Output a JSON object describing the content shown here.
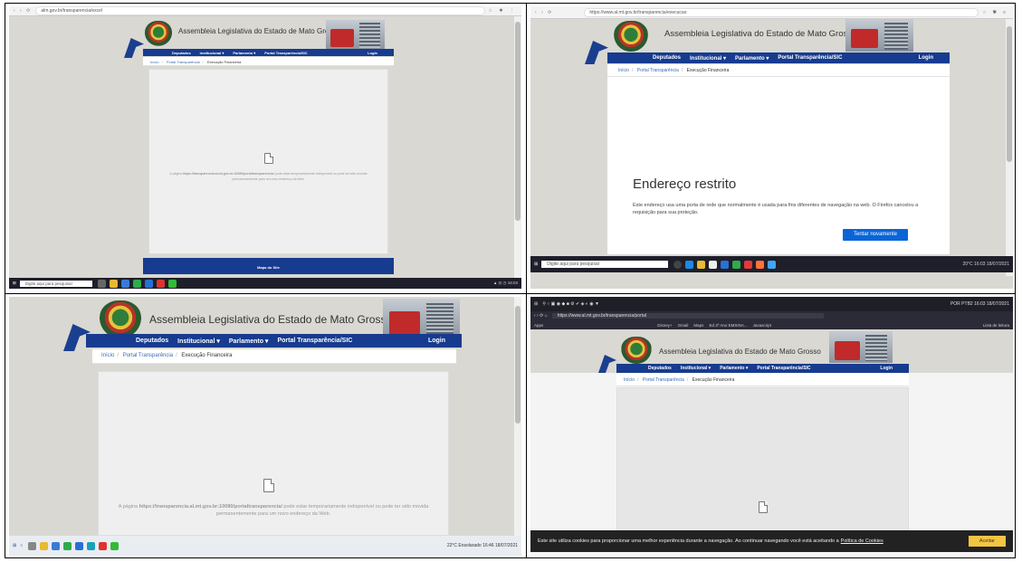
{
  "site": {
    "title": "Assembleia Legislativa do Estado de Mato Grosso",
    "nav": [
      "Deputados",
      "Institucional ▾",
      "Parlamento ▾",
      "Portal Transparência/SIC"
    ],
    "login": "Login",
    "breadcrumb": [
      "Início",
      "Portal Transparência",
      "Execução Financeira"
    ],
    "unavailable_msg_prefix": "A página ",
    "unavailable_url": "https://transparencia.al.mt.gov.br:10080/portaltransparencia/",
    "unavailable_msg_suffix": " pode estar temporariamente indisponível ou pode ter sido movida permanentemente para um novo endereço da Web.",
    "footer_link": "Mapa do Site"
  },
  "q1": {
    "url": "alm.gov.br/transparencia/excel",
    "taskbar_search": "Digite aqui para pesquisar"
  },
  "q2": {
    "url": "https://www.al.mt.gov.br/transparencia/execucao",
    "error_title": "Endereço restrito",
    "error_text": "Este endereço usa uma porta de rede que normalmente é usada para fins diferentes de navegação na web. O Firefox cancelou a requisição para sua proteção.",
    "retry": "Tentar novamente",
    "taskbar_search": "Digite aqui para pesquisar",
    "tray": "20°C   16:03  18/07/2021"
  },
  "q3": {
    "tray": "22°C  Ensolarado   16:46  18/07/2021"
  },
  "q4": {
    "url": "https://www.al.mt.gov.br/transparencia/portal",
    "bookmarks": [
      "Apps",
      "Disney+",
      "Gmail",
      "Maps",
      "Ed 3º Ano EMSINA...",
      "Javascript",
      "Lista de leitura"
    ],
    "tray": "POR PTB2  16:03  18/07/2021",
    "cookie_text": "Este site utiliza cookies para proporcionar uma melhor experiência durante a navegação. Ao continuar navegando você está aceitando a",
    "cookie_policy": "Política de Cookies",
    "accept": "Aceitar"
  },
  "colors": {
    "navbar": "#173b8e",
    "page_bg": "#d9d8d2",
    "retry": "#0a64d8",
    "accept": "#f5c542"
  }
}
